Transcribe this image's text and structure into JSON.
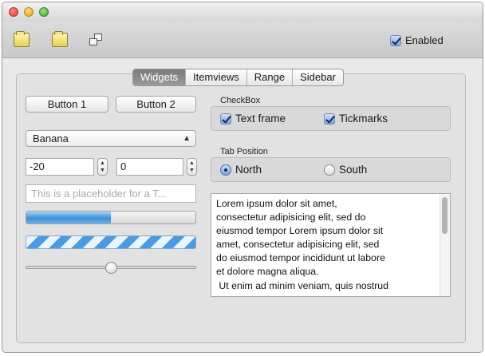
{
  "toolbar": {
    "icons": [
      "new-document-icon",
      "open-document-icon",
      "copy-icon"
    ],
    "enabled_label": "Enabled",
    "enabled_checked": true
  },
  "tabs": {
    "items": [
      {
        "label": "Widgets",
        "active": true
      },
      {
        "label": "Itemviews",
        "active": false
      },
      {
        "label": "Range",
        "active": false
      },
      {
        "label": "Sidebar",
        "active": false
      }
    ]
  },
  "widgets": {
    "button1": "Button 1",
    "button2": "Button 2",
    "combo_value": "Banana",
    "spin1_value": "-20",
    "spin2_value": "0",
    "line_edit_placeholder": "This is a placeholder for a T...",
    "progress_fraction": 0.5,
    "slider_fraction": 0.5
  },
  "checkbox_group": {
    "title": "CheckBox",
    "items": [
      {
        "label": "Text frame",
        "checked": true
      },
      {
        "label": "Tickmarks",
        "checked": true
      }
    ]
  },
  "tab_position_group": {
    "title": "Tab Position",
    "items": [
      {
        "label": "North",
        "selected": true
      },
      {
        "label": "South",
        "selected": false
      }
    ]
  },
  "text_area": {
    "text": "Lorem ipsum dolor sit amet,\nconsectetur adipisicing elit, sed do\neiusmod tempor Lorem ipsum dolor sit\namet, consectetur adipisicing elit, sed\ndo eiusmod tempor incididunt ut labore\net dolore magna aliqua.\n Ut enim ad minim veniam, quis nostrud"
  },
  "colors": {
    "accent": "#3d8fd8",
    "window_bg": "#e9e9e9",
    "active_tab": "#8a8a8a"
  }
}
